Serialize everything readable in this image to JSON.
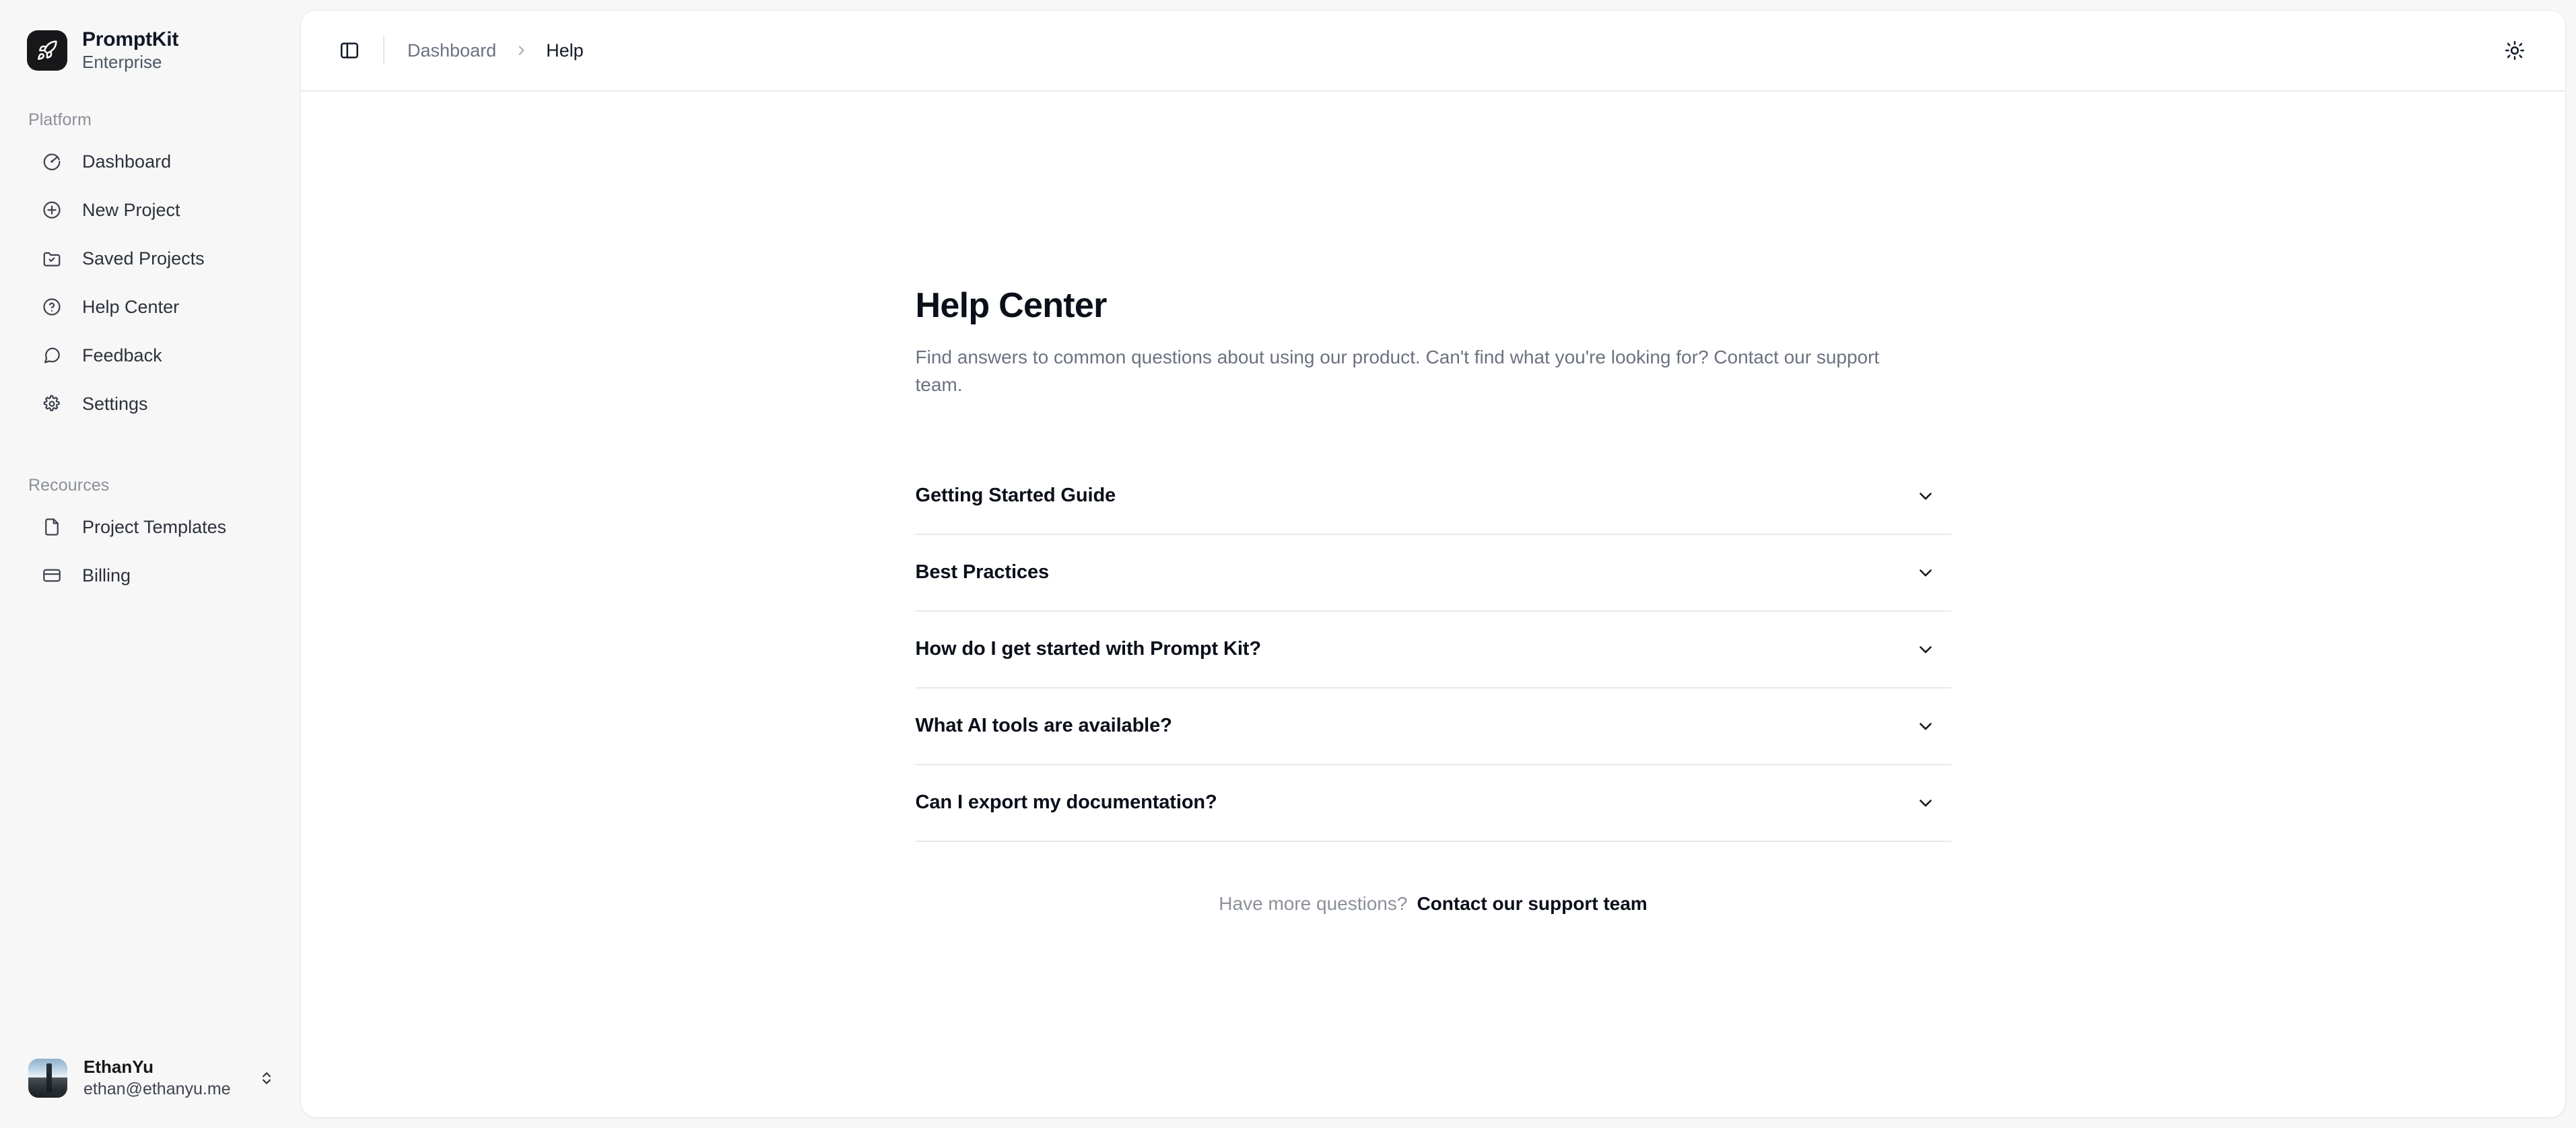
{
  "brand": {
    "name": "PromptKit",
    "plan": "Enterprise",
    "logo_icon": "rocket-icon",
    "logo_bg": "#18181b"
  },
  "sidebar": {
    "sections": [
      {
        "label": "Platform",
        "items": [
          {
            "label": "Dashboard",
            "icon": "gauge-icon"
          },
          {
            "label": "New Project",
            "icon": "plus-circle-icon"
          },
          {
            "label": "Saved Projects",
            "icon": "folder-check-icon"
          },
          {
            "label": "Help Center",
            "icon": "question-circle-icon"
          },
          {
            "label": "Feedback",
            "icon": "message-circle-icon"
          },
          {
            "label": "Settings",
            "icon": "gear-icon"
          }
        ]
      },
      {
        "label": "Recources",
        "items": [
          {
            "label": "Project Templates",
            "icon": "file-icon"
          },
          {
            "label": "Billing",
            "icon": "credit-card-icon"
          }
        ]
      }
    ],
    "user": {
      "name": "EthanYu",
      "email": "ethan@ethanyu.me",
      "avatar_icon": "avatar-photo",
      "chevron_icon": "chevrons-up-down-icon"
    }
  },
  "topbar": {
    "sidebar_toggle_icon": "panel-left-icon",
    "breadcrumb": {
      "parent": "Dashboard",
      "separator_icon": "chevron-right-icon",
      "current": "Help"
    },
    "theme_toggle_icon": "sun-icon"
  },
  "main": {
    "title": "Help Center",
    "subtitle": "Find answers to common questions about using our product. Can't find what you're looking for? Contact our support team.",
    "faq": [
      {
        "question": "Getting Started Guide",
        "chevron_icon": "chevron-down-icon",
        "expanded": false
      },
      {
        "question": "Best Practices",
        "chevron_icon": "chevron-down-icon",
        "expanded": false
      },
      {
        "question": "How do I get started with Prompt Kit?",
        "chevron_icon": "chevron-down-icon",
        "expanded": false
      },
      {
        "question": "What AI tools are available?",
        "chevron_icon": "chevron-down-icon",
        "expanded": false
      },
      {
        "question": "Can I export my documentation?",
        "chevron_icon": "chevron-down-icon",
        "expanded": false
      }
    ],
    "contact": {
      "lead": "Have more questions?",
      "link": "Contact our support team"
    }
  },
  "colors": {
    "app_bg": "#f7f7f8",
    "panel_bg": "#ffffff",
    "text_primary": "#0b0f1a",
    "text_muted": "#6b7280",
    "border": "#e6e9ed"
  }
}
